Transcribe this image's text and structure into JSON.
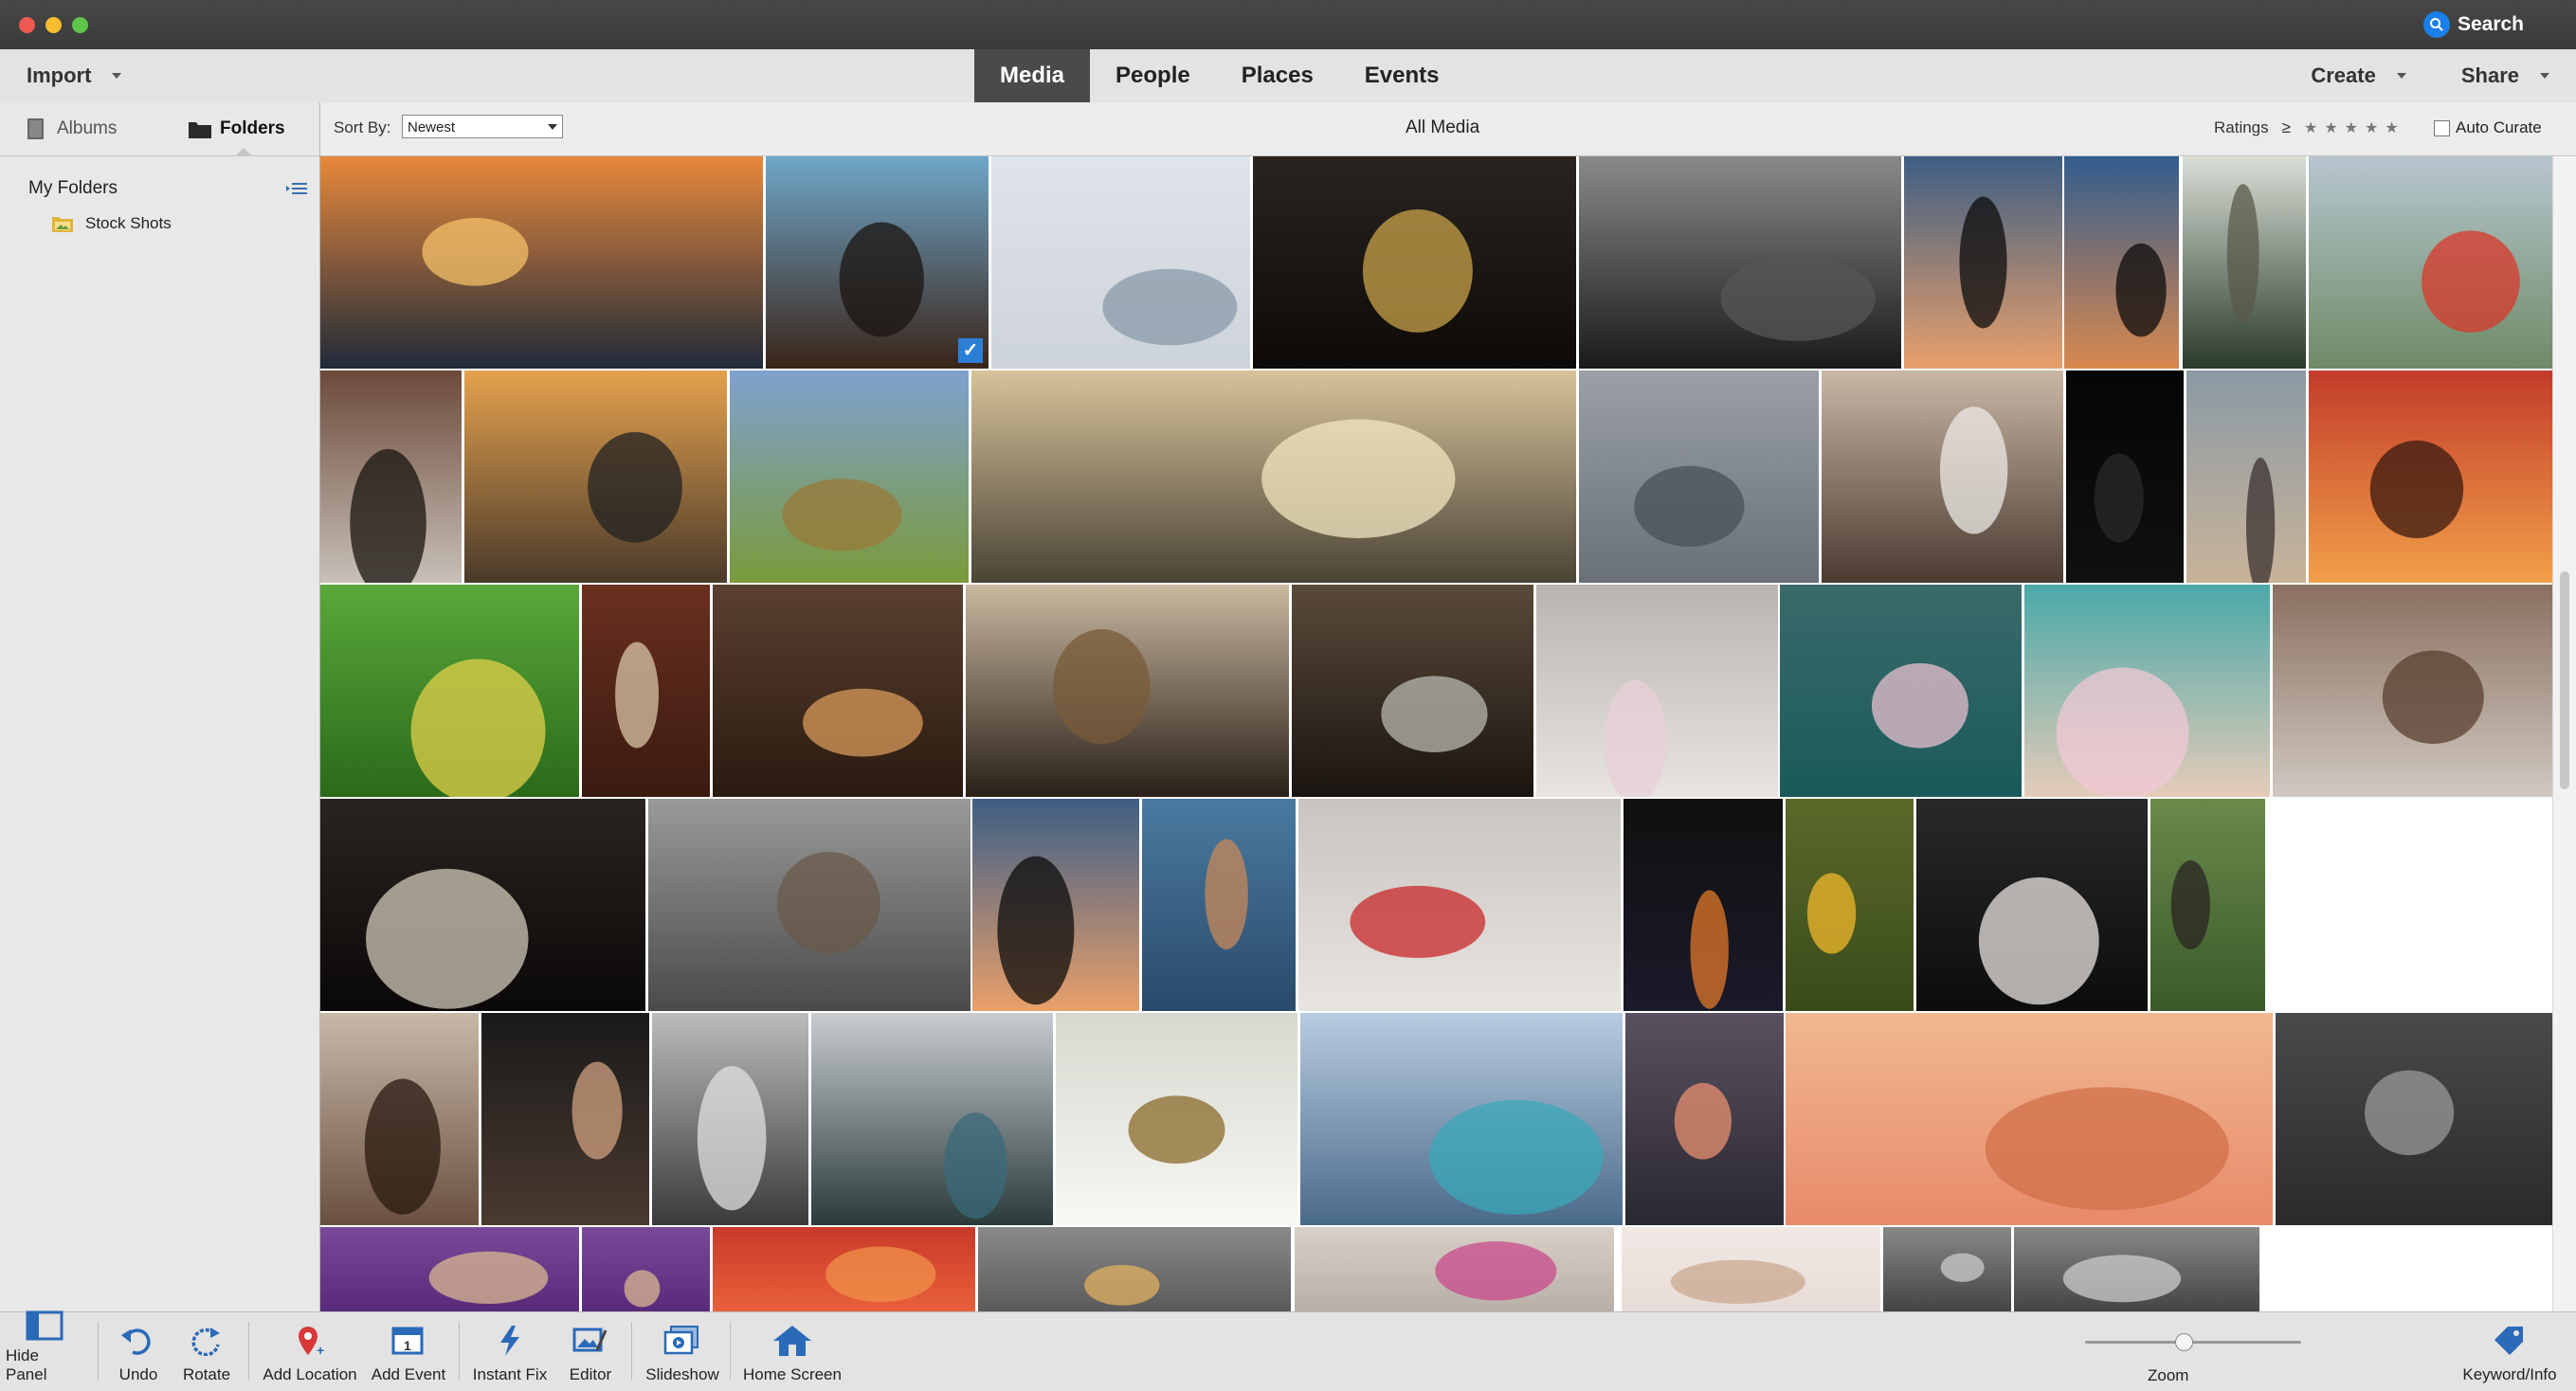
{
  "window": {
    "traffic_colors": [
      "#ee5a52",
      "#f5bd2f",
      "#5fc54a"
    ]
  },
  "search": {
    "label": "Search",
    "accent": "#1a7fe8"
  },
  "menubar": {
    "import_label": "Import",
    "tabs": [
      {
        "label": "Media",
        "active": true
      },
      {
        "label": "People",
        "active": false
      },
      {
        "label": "Places",
        "active": false
      },
      {
        "label": "Events",
        "active": false
      }
    ],
    "create_label": "Create",
    "share_label": "Share"
  },
  "left_panel": {
    "albums_label": "Albums",
    "folders_label": "Folders",
    "section_title": "My Folders",
    "folders": [
      {
        "label": "Stock Shots",
        "icon": "folder-image-icon"
      }
    ]
  },
  "sortbar": {
    "sort_label": "Sort By:",
    "sort_value": "Newest",
    "view_title": "All Media",
    "ratings_label": "Ratings",
    "ratings_operator": "≥",
    "stars": "★★★★★",
    "auto_curate_label": "Auto Curate",
    "auto_curate_checked": false
  },
  "grid": {
    "selected_count": 1,
    "photos": [
      {
        "subject": "sunset-rocky-coast"
      },
      {
        "subject": "woman-afro-portrait",
        "selected": true
      },
      {
        "subject": "snowy-forest-cabin"
      },
      {
        "subject": "woman-golden-headdress-window"
      },
      {
        "subject": "station-interior-crowd"
      },
      {
        "subject": "photographer-silhouette"
      },
      {
        "subject": "couple-silhouette-dusk"
      },
      {
        "subject": "suspension-bridge-forest"
      },
      {
        "subject": "tent-misty-hills"
      },
      {
        "subject": "woman-braids-sitting"
      },
      {
        "subject": "couple-tree-sunset-lake"
      },
      {
        "subject": "hay-bales-field"
      },
      {
        "subject": "horses-beach-sunrise"
      },
      {
        "subject": "foggy-field"
      },
      {
        "subject": "bride-phone-photo"
      },
      {
        "subject": "dark-silhouette"
      },
      {
        "subject": "woman-headband-profile"
      },
      {
        "subject": "sea-cave-sunset"
      },
      {
        "subject": "feathered-green-costume"
      },
      {
        "subject": "woman-arched-corridor"
      },
      {
        "subject": "ginger-cat-closeup"
      },
      {
        "subject": "book-stacks"
      },
      {
        "subject": "scooter-storefront"
      },
      {
        "subject": "cherry-blossom-bw"
      },
      {
        "subject": "cherry-blossom-river"
      },
      {
        "subject": "cherry-blossom-teal"
      },
      {
        "subject": "cat-lying-down"
      },
      {
        "subject": "typewriter-keys"
      },
      {
        "subject": "boat-foggy-lake"
      },
      {
        "subject": "photographer-silhouette-2"
      },
      {
        "subject": "red-haired-woman-lake"
      },
      {
        "subject": "dancer-red-pants"
      },
      {
        "subject": "soap-bubble-macro"
      },
      {
        "subject": "sunflowers"
      },
      {
        "subject": "bride-dark-doorway"
      },
      {
        "subject": "woman-park-jacket"
      },
      {
        "subject": "woman-long-hair-portrait"
      },
      {
        "subject": "woman-dark-portrait"
      },
      {
        "subject": "vintage-two-women-bw"
      },
      {
        "subject": "fjord-storm"
      },
      {
        "subject": "white-lily-macro"
      },
      {
        "subject": "mountain-lake-hikers"
      },
      {
        "subject": "rocky-shore-dusk"
      },
      {
        "subject": "pink-sky"
      },
      {
        "subject": "city-aerial-road"
      },
      {
        "subject": "lavender-field-hat"
      },
      {
        "subject": "lavender-field-hat-2"
      },
      {
        "subject": "red-abstract"
      },
      {
        "subject": "food-board"
      },
      {
        "subject": "child-camera"
      },
      {
        "subject": "bright-room"
      }
    ]
  },
  "bottombar": {
    "tools": [
      {
        "label": "Hide Panel",
        "icon": "hide-panel-icon"
      },
      {
        "label": "Undo",
        "icon": "undo-icon"
      },
      {
        "label": "Rotate",
        "icon": "rotate-icon"
      },
      {
        "label": "Add Location",
        "icon": "location-pin-icon"
      },
      {
        "label": "Add Event",
        "icon": "calendar-icon"
      },
      {
        "label": "Instant Fix",
        "icon": "lightning-icon"
      },
      {
        "label": "Editor",
        "icon": "editor-icon"
      },
      {
        "label": "Slideshow",
        "icon": "slideshow-icon"
      },
      {
        "label": "Home Screen",
        "icon": "home-icon"
      }
    ],
    "zoom_label": "Zoom",
    "zoom_level": 0.45,
    "keyword_label": "Keyword/Info"
  }
}
